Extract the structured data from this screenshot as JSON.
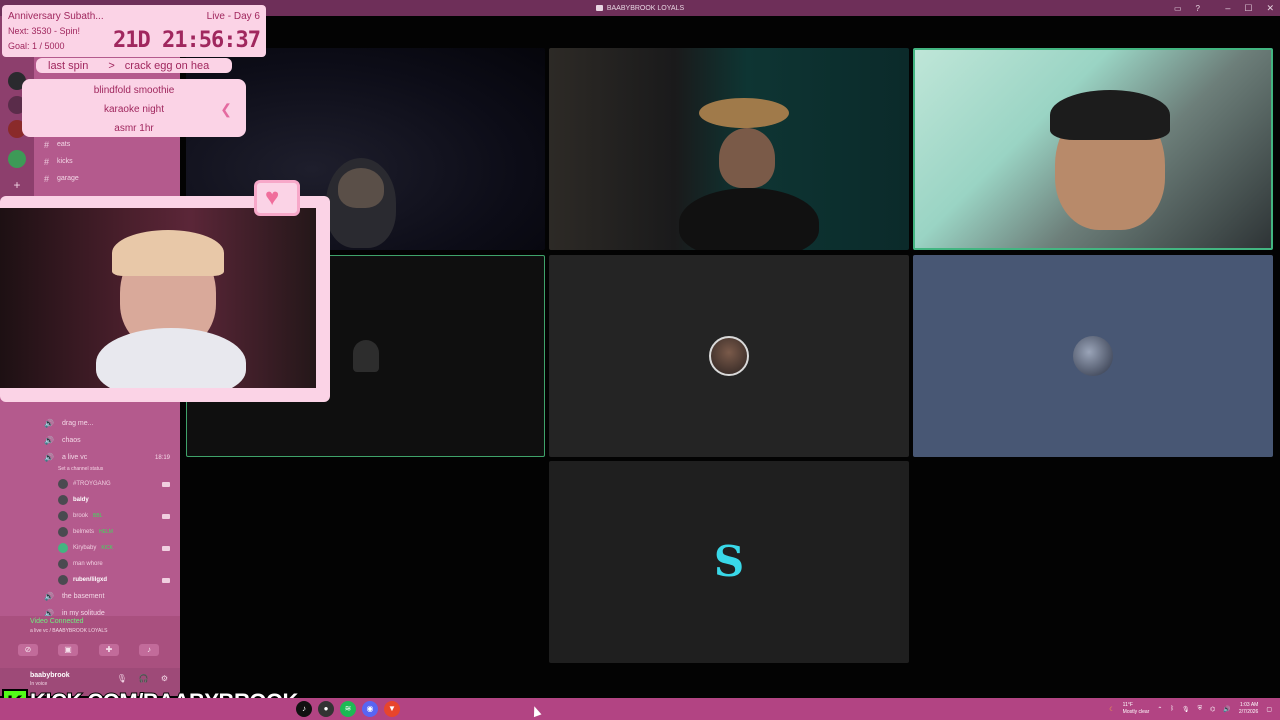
{
  "window": {
    "title": "BAABYBROOK LOYALS"
  },
  "subathon": {
    "title": "Anniversary Subath...",
    "live_day": "Live - Day 6",
    "next": "Next: 3530 - Spin!",
    "goal": "Goal: 1 / 5000",
    "timer": "21D 21:56:37"
  },
  "spin": {
    "label": "last spin",
    "arrow": ">",
    "result": "crack egg on hea"
  },
  "wheel": {
    "items": [
      "blindfold smoothie",
      "karaoke night",
      "asmr 1hr"
    ]
  },
  "channels": [
    {
      "label": "eats"
    },
    {
      "label": "kicks"
    },
    {
      "label": "garage"
    }
  ],
  "voice": {
    "top_channels": [
      {
        "label": "drag me..."
      },
      {
        "label": "chaos"
      }
    ],
    "active_channel": {
      "label": "a live vc",
      "time": "18:19",
      "status": "Set a channel status"
    },
    "members": [
      {
        "name": "#TROYGANG",
        "tag": "",
        "cam": true,
        "bold": false
      },
      {
        "name": "baldy",
        "tag": "",
        "cam": false,
        "bold": true
      },
      {
        "name": "brook",
        "tag": "BBL",
        "cam": true,
        "bold": false
      },
      {
        "name": "belmets",
        "tag": "HELM",
        "cam": false,
        "bold": false
      },
      {
        "name": "Kirybaby",
        "tag": "KICK",
        "cam": true,
        "bold": false
      },
      {
        "name": "man whore",
        "tag": "",
        "cam": false,
        "bold": false
      },
      {
        "name": "ruben/lilgxd",
        "tag": "",
        "cam": true,
        "bold": true
      }
    ],
    "bottom_channels": [
      {
        "label": "the basement"
      },
      {
        "label": "in my solitude"
      }
    ]
  },
  "vc_panel": {
    "status": "Video Connected",
    "sub": "a live vc / BAABYBROOK LOYALS"
  },
  "user": {
    "name": "baabybrook",
    "status": "In voice"
  },
  "kick": {
    "k": "K",
    "url": "KICK.COM/BAABYBROOK"
  },
  "tiles": [
    {
      "id": "t1",
      "kind": "video"
    },
    {
      "id": "t2",
      "kind": "video"
    },
    {
      "id": "t3",
      "kind": "video",
      "speaking": true
    },
    {
      "id": "t4",
      "kind": "avatar",
      "speaking": true
    },
    {
      "id": "t5",
      "kind": "avatar"
    },
    {
      "id": "t6",
      "kind": "avatar"
    },
    {
      "id": "t7",
      "kind": "avatar",
      "glyph": "S"
    }
  ],
  "tray": {
    "temp": "11°F",
    "weather": "Mostly clear",
    "time": "1:03 AM",
    "date": "2/7/2026"
  },
  "colors": {
    "sidebar": "#b45a8d",
    "accent_pink": "#fbd3e6",
    "speaking": "#43b581",
    "taskbar": "#b24483",
    "kick_green": "#53fc18"
  }
}
